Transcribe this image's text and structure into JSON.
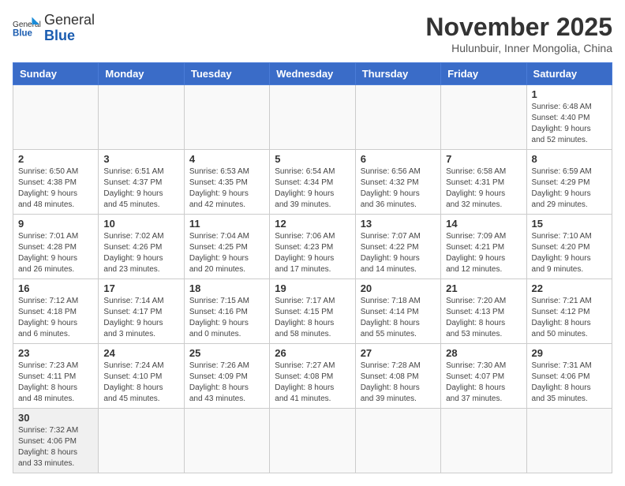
{
  "header": {
    "logo_general": "General",
    "logo_blue": "Blue",
    "month_title": "November 2025",
    "location": "Hulunbuir, Inner Mongolia, China"
  },
  "weekdays": [
    "Sunday",
    "Monday",
    "Tuesday",
    "Wednesday",
    "Thursday",
    "Friday",
    "Saturday"
  ],
  "weeks": [
    [
      {
        "day": "",
        "info": ""
      },
      {
        "day": "",
        "info": ""
      },
      {
        "day": "",
        "info": ""
      },
      {
        "day": "",
        "info": ""
      },
      {
        "day": "",
        "info": ""
      },
      {
        "day": "",
        "info": ""
      },
      {
        "day": "1",
        "info": "Sunrise: 6:48 AM\nSunset: 4:40 PM\nDaylight: 9 hours\nand 52 minutes."
      }
    ],
    [
      {
        "day": "2",
        "info": "Sunrise: 6:50 AM\nSunset: 4:38 PM\nDaylight: 9 hours\nand 48 minutes."
      },
      {
        "day": "3",
        "info": "Sunrise: 6:51 AM\nSunset: 4:37 PM\nDaylight: 9 hours\nand 45 minutes."
      },
      {
        "day": "4",
        "info": "Sunrise: 6:53 AM\nSunset: 4:35 PM\nDaylight: 9 hours\nand 42 minutes."
      },
      {
        "day": "5",
        "info": "Sunrise: 6:54 AM\nSunset: 4:34 PM\nDaylight: 9 hours\nand 39 minutes."
      },
      {
        "day": "6",
        "info": "Sunrise: 6:56 AM\nSunset: 4:32 PM\nDaylight: 9 hours\nand 36 minutes."
      },
      {
        "day": "7",
        "info": "Sunrise: 6:58 AM\nSunset: 4:31 PM\nDaylight: 9 hours\nand 32 minutes."
      },
      {
        "day": "8",
        "info": "Sunrise: 6:59 AM\nSunset: 4:29 PM\nDaylight: 9 hours\nand 29 minutes."
      }
    ],
    [
      {
        "day": "9",
        "info": "Sunrise: 7:01 AM\nSunset: 4:28 PM\nDaylight: 9 hours\nand 26 minutes."
      },
      {
        "day": "10",
        "info": "Sunrise: 7:02 AM\nSunset: 4:26 PM\nDaylight: 9 hours\nand 23 minutes."
      },
      {
        "day": "11",
        "info": "Sunrise: 7:04 AM\nSunset: 4:25 PM\nDaylight: 9 hours\nand 20 minutes."
      },
      {
        "day": "12",
        "info": "Sunrise: 7:06 AM\nSunset: 4:23 PM\nDaylight: 9 hours\nand 17 minutes."
      },
      {
        "day": "13",
        "info": "Sunrise: 7:07 AM\nSunset: 4:22 PM\nDaylight: 9 hours\nand 14 minutes."
      },
      {
        "day": "14",
        "info": "Sunrise: 7:09 AM\nSunset: 4:21 PM\nDaylight: 9 hours\nand 12 minutes."
      },
      {
        "day": "15",
        "info": "Sunrise: 7:10 AM\nSunset: 4:20 PM\nDaylight: 9 hours\nand 9 minutes."
      }
    ],
    [
      {
        "day": "16",
        "info": "Sunrise: 7:12 AM\nSunset: 4:18 PM\nDaylight: 9 hours\nand 6 minutes."
      },
      {
        "day": "17",
        "info": "Sunrise: 7:14 AM\nSunset: 4:17 PM\nDaylight: 9 hours\nand 3 minutes."
      },
      {
        "day": "18",
        "info": "Sunrise: 7:15 AM\nSunset: 4:16 PM\nDaylight: 9 hours\nand 0 minutes."
      },
      {
        "day": "19",
        "info": "Sunrise: 7:17 AM\nSunset: 4:15 PM\nDaylight: 8 hours\nand 58 minutes."
      },
      {
        "day": "20",
        "info": "Sunrise: 7:18 AM\nSunset: 4:14 PM\nDaylight: 8 hours\nand 55 minutes."
      },
      {
        "day": "21",
        "info": "Sunrise: 7:20 AM\nSunset: 4:13 PM\nDaylight: 8 hours\nand 53 minutes."
      },
      {
        "day": "22",
        "info": "Sunrise: 7:21 AM\nSunset: 4:12 PM\nDaylight: 8 hours\nand 50 minutes."
      }
    ],
    [
      {
        "day": "23",
        "info": "Sunrise: 7:23 AM\nSunset: 4:11 PM\nDaylight: 8 hours\nand 48 minutes."
      },
      {
        "day": "24",
        "info": "Sunrise: 7:24 AM\nSunset: 4:10 PM\nDaylight: 8 hours\nand 45 minutes."
      },
      {
        "day": "25",
        "info": "Sunrise: 7:26 AM\nSunset: 4:09 PM\nDaylight: 8 hours\nand 43 minutes."
      },
      {
        "day": "26",
        "info": "Sunrise: 7:27 AM\nSunset: 4:08 PM\nDaylight: 8 hours\nand 41 minutes."
      },
      {
        "day": "27",
        "info": "Sunrise: 7:28 AM\nSunset: 4:08 PM\nDaylight: 8 hours\nand 39 minutes."
      },
      {
        "day": "28",
        "info": "Sunrise: 7:30 AM\nSunset: 4:07 PM\nDaylight: 8 hours\nand 37 minutes."
      },
      {
        "day": "29",
        "info": "Sunrise: 7:31 AM\nSunset: 4:06 PM\nDaylight: 8 hours\nand 35 minutes."
      }
    ],
    [
      {
        "day": "30",
        "info": "Sunrise: 7:32 AM\nSunset: 4:06 PM\nDaylight: 8 hours\nand 33 minutes."
      },
      {
        "day": "",
        "info": ""
      },
      {
        "day": "",
        "info": ""
      },
      {
        "day": "",
        "info": ""
      },
      {
        "day": "",
        "info": ""
      },
      {
        "day": "",
        "info": ""
      },
      {
        "day": "",
        "info": ""
      }
    ]
  ]
}
